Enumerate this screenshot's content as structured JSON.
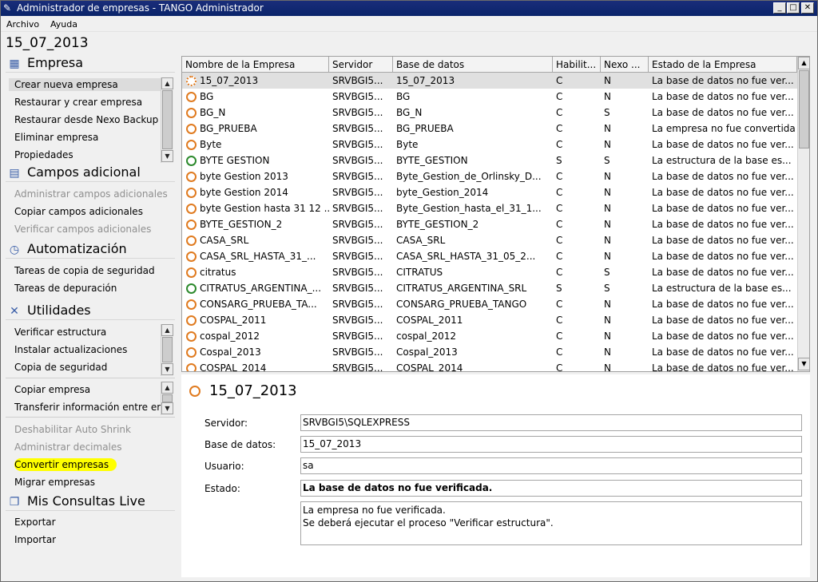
{
  "window": {
    "title": "Administrador de empresas - TANGO Administrador",
    "minimize": "_",
    "maximize": "□",
    "close": "✕"
  },
  "menu": {
    "file": "Archivo",
    "help": "Ayuda"
  },
  "current_company": "15_07_2013",
  "sidebar": {
    "empresa": {
      "title": "Empresa",
      "items": [
        "Crear nueva empresa",
        "Restaurar y crear empresa",
        "Restaurar desde Nexo Backup",
        "Eliminar empresa",
        "Propiedades"
      ]
    },
    "campos": {
      "title": "Campos adicional",
      "items": [
        "Administrar campos adicionales",
        "Copiar campos adicionales",
        "Verificar campos adicionales"
      ]
    },
    "automatizacion": {
      "title": "Automatización",
      "items": [
        "Tareas de copia de seguridad",
        "Tareas de depuración"
      ]
    },
    "utilidades": {
      "title": "Utilidades",
      "group1": [
        "Verificar estructura",
        "Instalar actualizaciones",
        "Copia de seguridad"
      ],
      "group2": [
        "Copiar empresa",
        "Transferir información entre empresas"
      ],
      "group3": [
        "Deshabilitar Auto Shrink",
        "Administrar decimales",
        "Convertir empresas",
        "Migrar empresas"
      ]
    },
    "consultas": {
      "title": "Mis Consultas Live",
      "items": [
        "Exportar",
        "Importar"
      ]
    }
  },
  "grid": {
    "columns": [
      "Nombre de la Empresa",
      "Servidor",
      "Base de datos",
      "Habilit...",
      "Nexo ...",
      "Estado de la Empresa"
    ],
    "rows": [
      {
        "status": "orange",
        "name": "15_07_2013",
        "server": "SRVBGI5...",
        "db": "15_07_2013",
        "hab": "C",
        "nexo": "N",
        "estado": "La base de datos no fue ver..."
      },
      {
        "status": "orange",
        "name": "BG",
        "server": "SRVBGI5...",
        "db": "BG",
        "hab": "C",
        "nexo": "N",
        "estado": "La base de datos no fue ver..."
      },
      {
        "status": "orange",
        "name": "BG_N",
        "server": "SRVBGI5...",
        "db": "BG_N",
        "hab": "C",
        "nexo": "S",
        "estado": "La base de datos no fue ver..."
      },
      {
        "status": "orange",
        "name": "BG_PRUEBA",
        "server": "SRVBGI5...",
        "db": "BG_PRUEBA",
        "hab": "C",
        "nexo": "N",
        "estado": "La empresa no fue convertida"
      },
      {
        "status": "orange",
        "name": "Byte",
        "server": "SRVBGI5...",
        "db": "Byte",
        "hab": "C",
        "nexo": "N",
        "estado": "La base de datos no fue ver..."
      },
      {
        "status": "green",
        "name": "BYTE GESTION",
        "server": "SRVBGI5...",
        "db": "BYTE_GESTION",
        "hab": "S",
        "nexo": "S",
        "estado": "La estructura de la base es..."
      },
      {
        "status": "orange",
        "name": "byte Gestion 2013",
        "server": "SRVBGI5...",
        "db": "Byte_Gestion_de_Orlinsky_D...",
        "hab": "C",
        "nexo": "N",
        "estado": "La base de datos no fue ver..."
      },
      {
        "status": "orange",
        "name": "byte Gestion 2014",
        "server": "SRVBGI5...",
        "db": "byte_Gestion_2014",
        "hab": "C",
        "nexo": "N",
        "estado": "La base de datos no fue ver..."
      },
      {
        "status": "orange",
        "name": "byte Gestion hasta 31 12 ...",
        "server": "SRVBGI5...",
        "db": "Byte_Gestion_hasta_el_31_1...",
        "hab": "C",
        "nexo": "N",
        "estado": "La base de datos no fue ver..."
      },
      {
        "status": "orange",
        "name": "BYTE_GESTION_2",
        "server": "SRVBGI5...",
        "db": "BYTE_GESTION_2",
        "hab": "C",
        "nexo": "N",
        "estado": "La base de datos no fue ver..."
      },
      {
        "status": "orange",
        "name": "CASA_SRL",
        "server": "SRVBGI5...",
        "db": "CASA_SRL",
        "hab": "C",
        "nexo": "N",
        "estado": "La base de datos no fue ver..."
      },
      {
        "status": "orange",
        "name": "CASA_SRL_HASTA_31_...",
        "server": "SRVBGI5...",
        "db": "CASA_SRL_HASTA_31_05_2...",
        "hab": "C",
        "nexo": "N",
        "estado": "La base de datos no fue ver..."
      },
      {
        "status": "orange",
        "name": "citratus",
        "server": "SRVBGI5...",
        "db": "CITRATUS",
        "hab": "C",
        "nexo": "S",
        "estado": "La base de datos no fue ver..."
      },
      {
        "status": "green",
        "name": "CITRATUS_ARGENTINA_...",
        "server": "SRVBGI5...",
        "db": "CITRATUS_ARGENTINA_SRL",
        "hab": "S",
        "nexo": "S",
        "estado": "La estructura de la base es..."
      },
      {
        "status": "orange",
        "name": "CONSARG_PRUEBA_TA...",
        "server": "SRVBGI5...",
        "db": "CONSARG_PRUEBA_TANGO",
        "hab": "C",
        "nexo": "N",
        "estado": "La base de datos no fue ver..."
      },
      {
        "status": "orange",
        "name": "COSPAL_2011",
        "server": "SRVBGI5...",
        "db": "COSPAL_2011",
        "hab": "C",
        "nexo": "N",
        "estado": "La base de datos no fue ver..."
      },
      {
        "status": "orange",
        "name": "cospal_2012",
        "server": "SRVBGI5...",
        "db": "cospal_2012",
        "hab": "C",
        "nexo": "N",
        "estado": "La base de datos no fue ver..."
      },
      {
        "status": "orange",
        "name": "Cospal_2013",
        "server": "SRVBGI5...",
        "db": "Cospal_2013",
        "hab": "C",
        "nexo": "N",
        "estado": "La base de datos no fue ver..."
      },
      {
        "status": "orange",
        "name": "COSPAL_2014",
        "server": "SRVBGI5...",
        "db": "COSPAL_2014",
        "hab": "C",
        "nexo": "N",
        "estado": "La base de datos no fue ver..."
      }
    ]
  },
  "details": {
    "title": "15_07_2013",
    "labels": {
      "servidor": "Servidor:",
      "base": "Base de datos:",
      "usuario": "Usuario:",
      "estado": "Estado:"
    },
    "values": {
      "servidor": "SRVBGI5\\SQLEXPRESS",
      "base": "15_07_2013",
      "usuario": "sa",
      "estado": "La base de datos no fue verificada.",
      "memo1": "La empresa no fue verificada.",
      "memo2": "Se deberá ejecutar el proceso \"Verificar estructura\"."
    }
  },
  "colors": {
    "status_orange": "#e07b20",
    "status_green": "#2d8a2d",
    "highlight": "#ffff00",
    "titlebar": "#0a246a"
  }
}
